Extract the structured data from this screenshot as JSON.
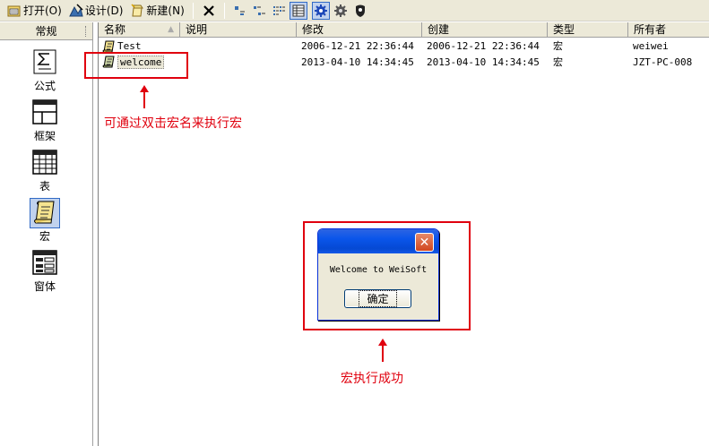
{
  "toolbar": {
    "open_label": "打开(O)",
    "design_label": "设计(D)",
    "new_label": "新建(N)"
  },
  "left_panel": {
    "header": "常规",
    "objects": [
      {
        "label": "公式",
        "icon": "formula-icon"
      },
      {
        "label": "框架",
        "icon": "frame-icon"
      },
      {
        "label": "表",
        "icon": "table-icon"
      },
      {
        "label": "宏",
        "icon": "macro-icon"
      },
      {
        "label": "窗体",
        "icon": "form-icon"
      }
    ],
    "selected": "宏"
  },
  "list": {
    "columns": [
      "名称",
      "说明",
      "修改",
      "创建",
      "类型",
      "所有者"
    ],
    "rows": [
      {
        "name": "Test",
        "desc": "",
        "modified": "2006-12-21 22:36:44",
        "created": "2006-12-21 22:36:44",
        "type": "宏",
        "owner": "weiwei"
      },
      {
        "name": "welcome",
        "desc": "",
        "modified": "2013-04-10 14:34:45",
        "created": "2013-04-10 14:34:45",
        "type": "宏",
        "owner": "JZT-PC-008"
      }
    ]
  },
  "annotations": {
    "double_click_note": "可通过双击宏名来执行宏",
    "success_note": "宏执行成功"
  },
  "dialog": {
    "message": "Welcome to WeiSoft",
    "ok_label": "确定"
  },
  "colors": {
    "annotation_red": "#e0000e",
    "xp_blue": "#0831d9",
    "chrome": "#ece9d8"
  }
}
